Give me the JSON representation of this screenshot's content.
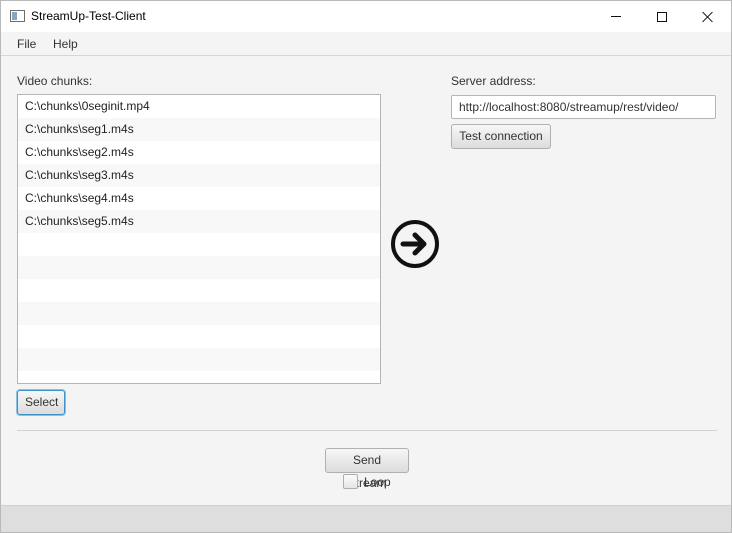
{
  "window": {
    "title": "StreamUp-Test-Client"
  },
  "menu": {
    "items": [
      "File",
      "Help"
    ]
  },
  "chunks": {
    "label": "Video chunks:",
    "items": [
      "C:\\chunks\\0seginit.mp4",
      "C:\\chunks\\seg1.m4s",
      "C:\\chunks\\seg2.m4s",
      "C:\\chunks\\seg3.m4s",
      "C:\\chunks\\seg4.m4s",
      "C:\\chunks\\seg5.m4s",
      "",
      "",
      "",
      "",
      "",
      ""
    ],
    "select_label": "Select"
  },
  "arrow_icon": "circle-arrow-right-icon",
  "server": {
    "label": "Server address:",
    "value": "http://localhost:8080/streamup/rest/video/",
    "test_label": "Test connection"
  },
  "send": {
    "label": "Send Stream"
  },
  "loop": {
    "label": "Loop",
    "checked": false
  }
}
